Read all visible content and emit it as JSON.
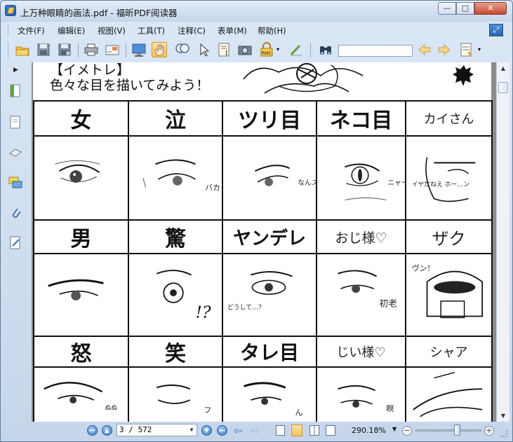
{
  "window": {
    "title": "上万种眼睛的画法.pdf - 福昕PDF阅读器",
    "min_label": "—",
    "max_label": "□",
    "close_label": "✕"
  },
  "menu": {
    "items": [
      {
        "label": "文件(F)"
      },
      {
        "label": "编辑(E)"
      },
      {
        "label": "视图(V)"
      },
      {
        "label": "工具(T)"
      },
      {
        "label": "注释(C)"
      },
      {
        "label": "表单(M)"
      },
      {
        "label": "帮助(H)"
      }
    ],
    "expand_icon": "expand-icon"
  },
  "toolbar": {
    "buttons": [
      "open-folder-icon",
      "save-icon",
      "save-as-icon",
      "print-icon",
      "email-icon",
      "fullscreen-icon",
      "hand-tool-icon",
      "zoom-tool-icon",
      "select-arrow-icon",
      "text-select-icon",
      "snapshot-icon",
      "rms-lock-icon",
      "sign-icon",
      "find-binoculars-icon",
      "prev-result-icon",
      "next-result-icon",
      "highlight-icon"
    ],
    "search_value": "",
    "rms_label": "RMS"
  },
  "document": {
    "heading_top": "【イメトレ】",
    "heading_sub": "色々な目を描いてみよう！",
    "table": {
      "row1_labels": [
        "女",
        "泣",
        "ツリ目",
        "ネコ目",
        "カイさん"
      ],
      "row1_notes": [
        "",
        "バカャ",
        "なんスか",
        "ニャー",
        "イヤだねえ  ホー…ン"
      ],
      "row2_labels": [
        "男",
        "驚",
        "ヤンデレ",
        "おじ様♡",
        "ザク"
      ],
      "row2_notes": [
        "",
        "!?",
        "どうして…?",
        "初老",
        "ヴン！"
      ],
      "row3_labels": [
        "怒",
        "笑",
        "タレ目",
        "じい様♡",
        "シャア"
      ],
      "row3_notes": [
        "ぬぬ",
        "フ",
        "ん",
        "瞑",
        ""
      ]
    }
  },
  "status": {
    "page_current": "3",
    "page_total": "572",
    "page_display": "3 / 572",
    "zoom": "290.18%",
    "zoom_level_fraction": 0.6
  },
  "colors": {
    "accent": "#3478c7",
    "close_red": "#c84a32",
    "frame": "#c6d6ea"
  }
}
